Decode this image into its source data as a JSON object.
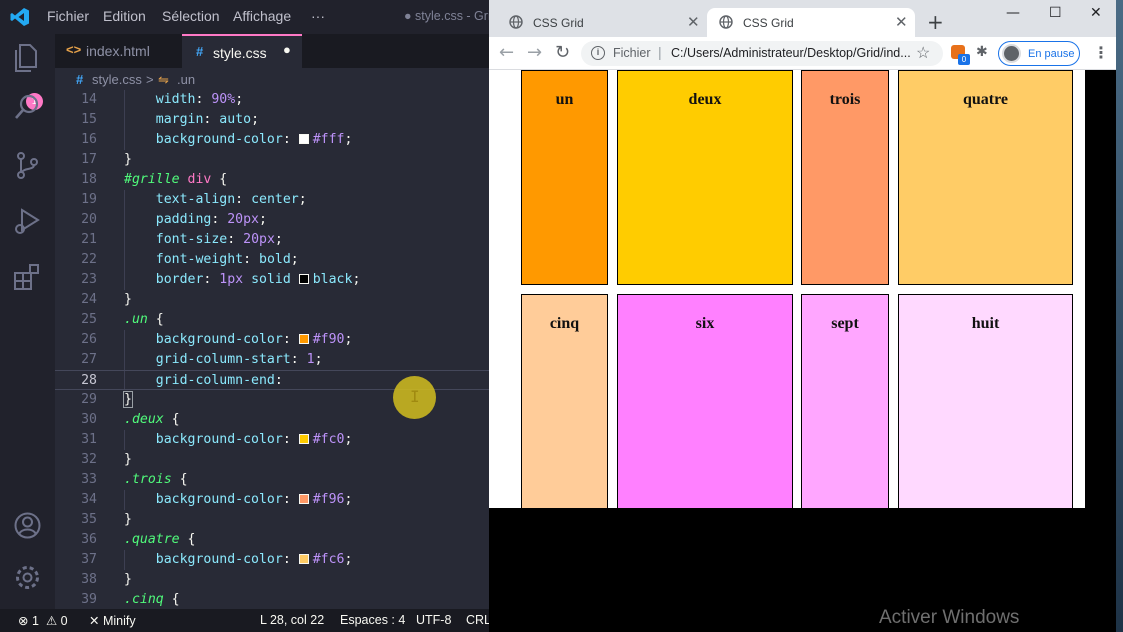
{
  "vscode": {
    "menu": [
      "Fichier",
      "Edition",
      "Sélection",
      "Affichage",
      "···"
    ],
    "window_title": "● style.css - Gri",
    "scm_badge": "1",
    "tabs": [
      {
        "icon": "<>",
        "label": "index.html"
      },
      {
        "icon": "#",
        "label": "style.css",
        "dirty_dot": "●"
      }
    ],
    "breadcrumb": {
      "file_icon": "#",
      "file": "style.css",
      "sep": ">",
      "symbol_icon": "⇋",
      "symbol": ".un"
    },
    "lines": [
      {
        "n": "14",
        "text": "    width: 90%;"
      },
      {
        "n": "15",
        "text": "    margin: auto;"
      },
      {
        "n": "16",
        "text": "    background-color: #fff;"
      },
      {
        "n": "17",
        "text": "}"
      },
      {
        "n": "18",
        "text": "#grille div {"
      },
      {
        "n": "19",
        "text": "    text-align: center;"
      },
      {
        "n": "20",
        "text": "    padding: 20px;"
      },
      {
        "n": "21",
        "text": "    font-size: 20px;"
      },
      {
        "n": "22",
        "text": "    font-weight: bold;"
      },
      {
        "n": "23",
        "text": "    border: 1px solid black;"
      },
      {
        "n": "24",
        "text": "}"
      },
      {
        "n": "25",
        "text": ".un {"
      },
      {
        "n": "26",
        "text": "    background-color: #f90;"
      },
      {
        "n": "27",
        "text": "    grid-column-start: 1;"
      },
      {
        "n": "28",
        "text": "    grid-column-end: "
      },
      {
        "n": "29",
        "text": "}"
      },
      {
        "n": "30",
        "text": ".deux {"
      },
      {
        "n": "31",
        "text": "    background-color: #fc0;"
      },
      {
        "n": "32",
        "text": "}"
      },
      {
        "n": "33",
        "text": ".trois {"
      },
      {
        "n": "34",
        "text": "    background-color: #f96;"
      },
      {
        "n": "35",
        "text": "}"
      },
      {
        "n": "36",
        "text": ".quatre {"
      },
      {
        "n": "37",
        "text": "    background-color: #fc6;"
      },
      {
        "n": "38",
        "text": "}"
      },
      {
        "n": "39",
        "text": ".cinq {"
      }
    ],
    "text_cursor_glyph": "I",
    "status": {
      "errors": "⊗ 1",
      "warnings": "⚠ 0",
      "minify": "✕ Minify",
      "position": "L 28, col 22",
      "spaces": "Espaces : 4",
      "encoding": "UTF-8",
      "eol": "CRL"
    }
  },
  "chrome": {
    "tabs": [
      {
        "title": "CSS Grid",
        "close": "✕"
      },
      {
        "title": "CSS Grid",
        "close": "✕"
      }
    ],
    "new_tab": "+",
    "window_buttons": {
      "minimize": "—",
      "maximize": "☐",
      "close": "✕"
    },
    "nav": {
      "back": "←",
      "forward": "→",
      "reload": "↻"
    },
    "address": {
      "info": "i",
      "secure_label": "Fichier",
      "separator": "|",
      "url": "C:/Users/Administrateur/Desktop/Grid/ind...",
      "star": "☆"
    },
    "extension_badge": "0",
    "puzzle": "✱",
    "profile_label": "En pause",
    "menu": "⋮"
  },
  "grid_page": {
    "cells": [
      {
        "label": "un",
        "color": "#ff9900"
      },
      {
        "label": "deux",
        "color": "#ffcc00"
      },
      {
        "label": "trois",
        "color": "#ff9966"
      },
      {
        "label": "quatre",
        "color": "#ffcc66"
      },
      {
        "label": "cinq",
        "color": "#ffcc99"
      },
      {
        "label": "six",
        "color": "#ff80ff"
      },
      {
        "label": "sept",
        "color": "#ffa6ff"
      },
      {
        "label": "huit",
        "color": "#ffd9ff"
      }
    ]
  },
  "watermark": "Activer Windows",
  "colors": {
    "accent_pink": "#ff79c6",
    "editor_bg": "#282a36",
    "swatch_white": "#ffffff",
    "swatch_black": "#000000",
    "swatch_un": "#ff9900",
    "swatch_deux": "#ffcc00",
    "swatch_trois": "#ff9966",
    "swatch_quatre": "#ffcc66"
  }
}
